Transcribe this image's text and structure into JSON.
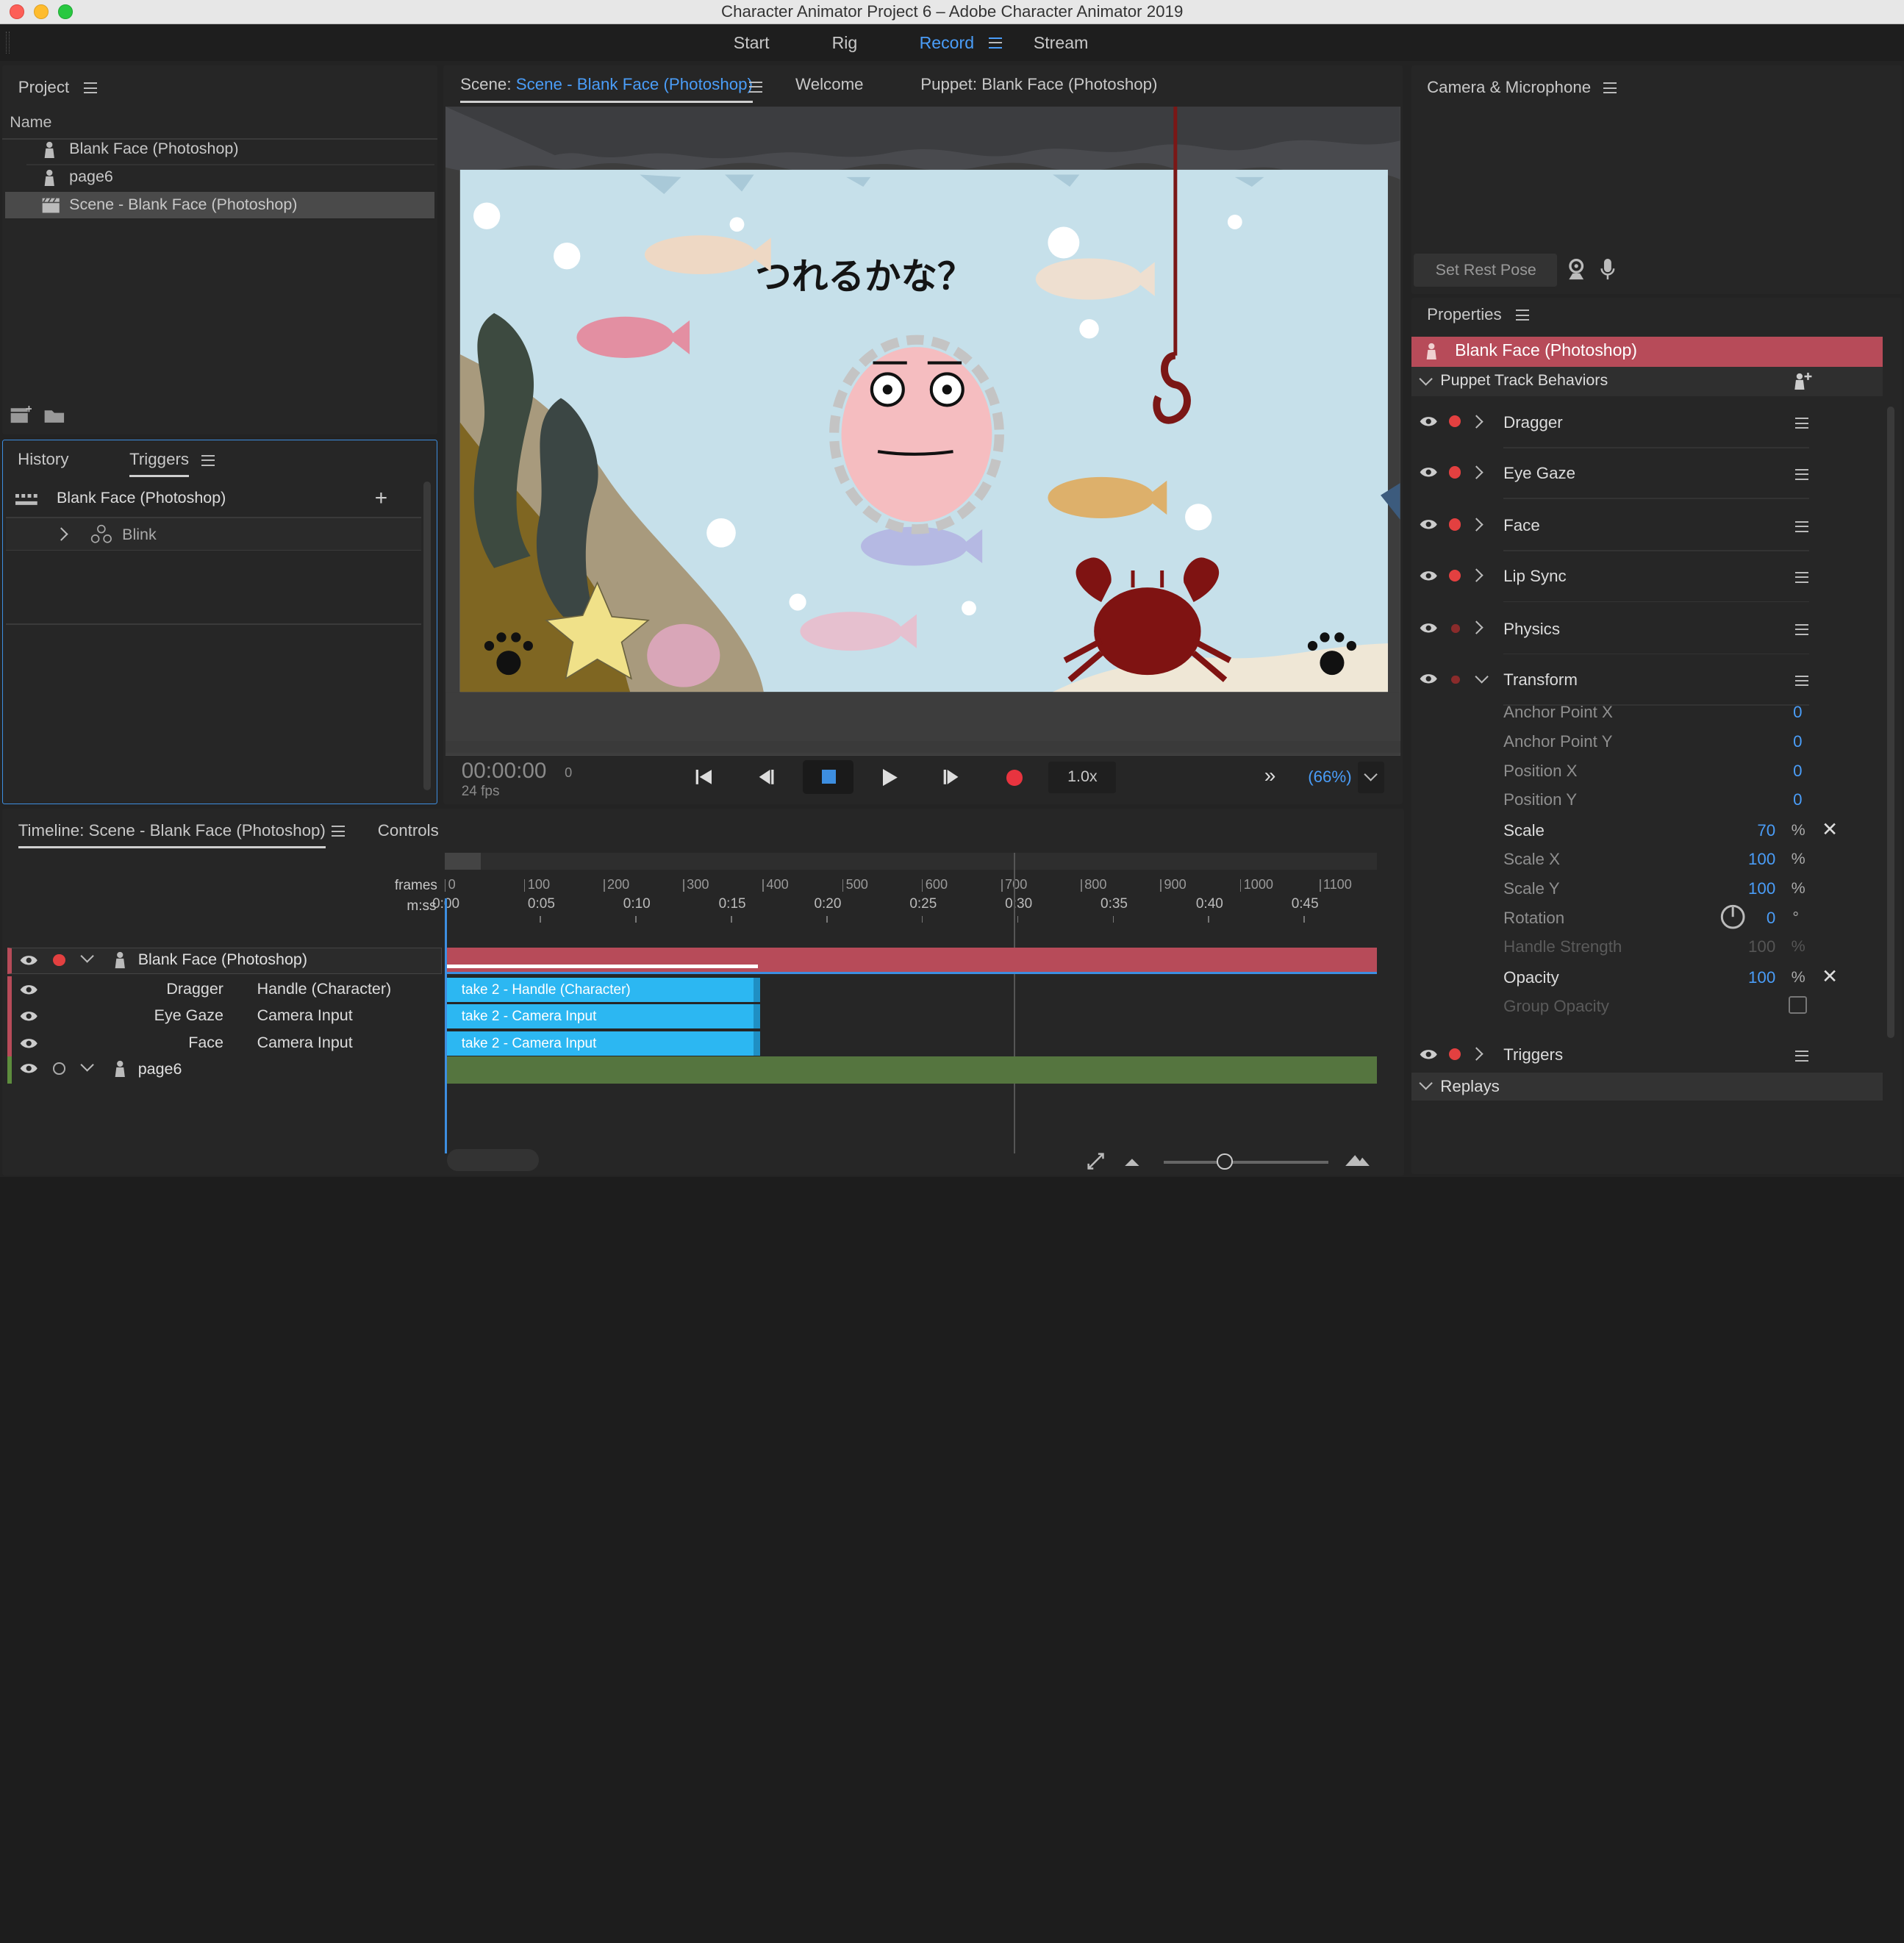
{
  "window": {
    "title": "Character Animator Project 6 – Adobe Character Animator 2019"
  },
  "workspace": {
    "tabs": [
      "Start",
      "Rig",
      "Record",
      "Stream"
    ],
    "active": "Record"
  },
  "project": {
    "title": "Project",
    "col_name": "Name",
    "items": [
      "Blank Face (Photoshop)",
      "page6",
      "Scene - Blank Face (Photoshop)"
    ]
  },
  "triggers_panel": {
    "tab_history": "History",
    "tab_triggers": "Triggers",
    "puppet": "Blank Face (Photoshop)",
    "item": "Blink"
  },
  "scene_panel": {
    "tab_prefix": "Scene:",
    "tab_scene": "Scene - Blank Face (Photoshop)",
    "tab_welcome": "Welcome",
    "tab_puppet": "Puppet: Blank Face (Photoshop)",
    "artwork_text": "つれるかな？"
  },
  "transport": {
    "timecode": "00:00:00",
    "frame": "0",
    "fps": "24 fps",
    "speed": "1.0x",
    "zoom": "(66%)"
  },
  "camera": {
    "title": "Camera & Microphone",
    "rest_pose": "Set Rest Pose"
  },
  "properties": {
    "title": "Properties",
    "puppet": "Blank Face (Photoshop)",
    "section": "Puppet Track Behaviors",
    "behaviors": [
      "Dragger",
      "Eye Gaze",
      "Face",
      "Lip Sync",
      "Physics",
      "Transform"
    ],
    "transform": [
      {
        "name": "Anchor Point X",
        "value": "0",
        "unit": ""
      },
      {
        "name": "Anchor Point Y",
        "value": "0",
        "unit": ""
      },
      {
        "name": "Position X",
        "value": "0",
        "unit": ""
      },
      {
        "name": "Position Y",
        "value": "0",
        "unit": ""
      },
      {
        "name": "Scale",
        "value": "70",
        "unit": "%"
      },
      {
        "name": "Scale X",
        "value": "100",
        "unit": "%"
      },
      {
        "name": "Scale Y",
        "value": "100",
        "unit": "%"
      },
      {
        "name": "Rotation",
        "value": "0",
        "unit": "°"
      },
      {
        "name": "Handle Strength",
        "value": "100",
        "unit": "%"
      },
      {
        "name": "Opacity",
        "value": "100",
        "unit": "%"
      },
      {
        "name": "Group Opacity",
        "value": "",
        "unit": ""
      }
    ],
    "triggers": "Triggers",
    "replays": "Replays"
  },
  "timeline": {
    "tab": "Timeline: Scene - Blank Face (Photoshop)",
    "controls_tab": "Controls",
    "frames_label": "frames",
    "mss_label": "m:ss",
    "frame_ticks": [
      "0",
      "100",
      "200",
      "300",
      "400",
      "500",
      "600",
      "700",
      "800",
      "900",
      "1000",
      "1100"
    ],
    "time_ticks": [
      "0:00",
      "0:05",
      "0:10",
      "0:15",
      "0:20",
      "0:25",
      "0:30",
      "0:35",
      "0:40",
      "0:45"
    ],
    "tracks": {
      "puppet": "Blank Face (Photoshop)",
      "rows": [
        {
          "name": "Dragger",
          "input": "Handle (Character)",
          "clip": "take 2 - Handle (Character)"
        },
        {
          "name": "Eye Gaze",
          "input": "Camera Input",
          "clip": "take 2 - Camera Input"
        },
        {
          "name": "Face",
          "input": "Camera Input",
          "clip": "take 2 - Camera Input"
        }
      ],
      "page": "page6"
    }
  }
}
